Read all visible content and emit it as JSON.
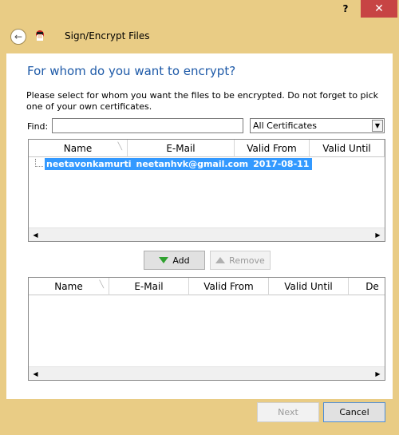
{
  "window": {
    "help_label": "?",
    "close_label": "✕",
    "title": "Sign/Encrypt Files",
    "back_icon": "←"
  },
  "page": {
    "heading": "For whom do you want to encrypt?",
    "instructions": "Please select for whom you want the files to be encrypted. Do not forget to pick one of your own certificates."
  },
  "find": {
    "label": "Find:",
    "value": "",
    "filter_selected": "All Certificates"
  },
  "available_list": {
    "columns": [
      "Name",
      "E-Mail",
      "Valid From",
      "Valid Until"
    ],
    "rows": [
      {
        "name": "neetavonkamurti",
        "email": "neetanhvk@gmail.com",
        "valid_from": "2017-08-11"
      }
    ]
  },
  "actions": {
    "add_label": "Add",
    "remove_label": "Remove"
  },
  "selected_list": {
    "columns": [
      "Name",
      "E-Mail",
      "Valid From",
      "Valid Until",
      "De"
    ]
  },
  "footer": {
    "next_label": "Next",
    "cancel_label": "Cancel"
  },
  "colors": {
    "frame": "#e9cc85",
    "heading": "#1e5aa8",
    "selection": "#3399ff",
    "close": "#c74444"
  }
}
